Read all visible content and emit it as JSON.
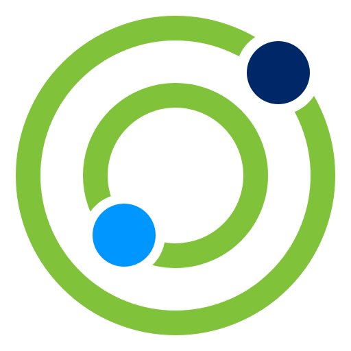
{
  "logo": {
    "icon": "orbit-rings-logo-icon",
    "colors": {
      "ring": "#80C33A",
      "outer_dot": "#002868",
      "inner_dot": "#0096FF",
      "background": "#FFFFFF"
    }
  }
}
